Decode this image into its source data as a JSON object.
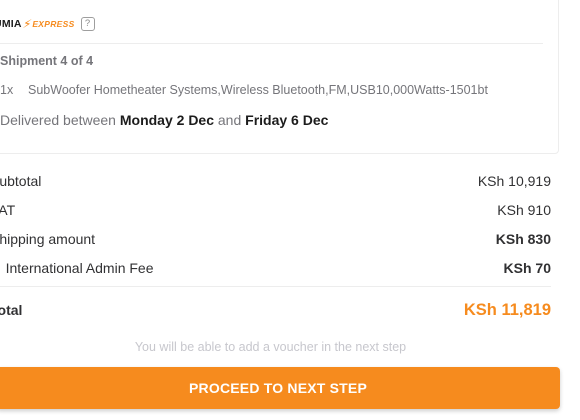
{
  "colors": {
    "accent": "#f68b1e",
    "text_dark": "#313133",
    "text_muted": "#75757a"
  },
  "shipment": {
    "logo_brand": "JUMIA",
    "logo_express": "EXPRESS",
    "help_icon_glyph": "?",
    "label": "Shipment 4 of 4",
    "item": {
      "qty": "1x",
      "name": "SubWoofer Hometheater Systems,Wireless Bluetooth,FM,USB10,000Watts-1501bt"
    },
    "delivery": {
      "prefix": "Delivered between",
      "start": "Monday 2 Dec",
      "joiner": "and",
      "end": "Friday 6 Dec"
    }
  },
  "summary": [
    {
      "label": "Subtotal",
      "value": "KSh 10,919",
      "bold": false
    },
    {
      "label": "VAT",
      "value": "KSh 910",
      "bold": false
    },
    {
      "label": "Shipping amount",
      "value": "KSh 830",
      "bold": true
    },
    {
      "label": "✓ International Admin Fee",
      "value": "KSh 70",
      "bold": true
    }
  ],
  "total": {
    "label": "Total",
    "value": "KSh 11,819"
  },
  "voucher_note": "You will be able to add a voucher in the next step",
  "proceed_button_label": "PROCEED TO NEXT STEP"
}
